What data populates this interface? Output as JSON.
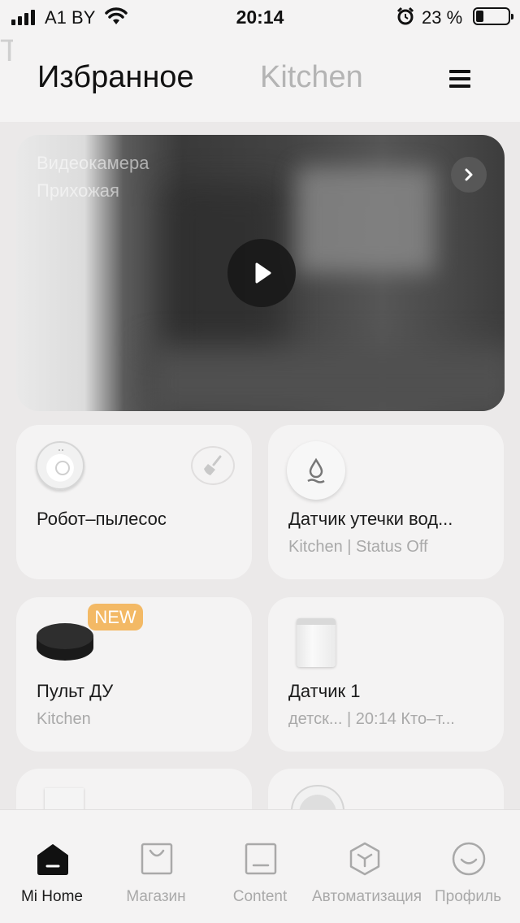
{
  "status_bar": {
    "carrier": "A1 BY",
    "time": "20:14",
    "battery_percent": "23 %",
    "battery_level": 0.23,
    "icons": [
      "signal-icon",
      "wifi-icon",
      "alarm-icon",
      "battery-icon"
    ]
  },
  "header": {
    "tabs": [
      {
        "label": "Избранное",
        "active": true
      },
      {
        "label": "Kitchen",
        "active": false
      },
      {
        "label": "Т",
        "active": false
      }
    ],
    "menu_icon": "menu-icon"
  },
  "camera": {
    "name": "Видеокамера",
    "room": "Прихожая",
    "next_icon": "chevron-right-icon",
    "play_icon": "play-icon"
  },
  "devices": [
    {
      "name": "Робот–пылесос",
      "sub": "",
      "icon": "robot-vacuum-icon",
      "action_icon": "broom-icon"
    },
    {
      "name": "Датчик утечки вод...",
      "sub": "Kitchen | Status Off",
      "icon": "water-leak-sensor-icon"
    },
    {
      "name": "Пульт ДУ",
      "sub": "Kitchen",
      "icon": "ir-remote-hub-icon",
      "badge": "NEW"
    },
    {
      "name": "Датчик 1",
      "sub": "детск... | 20:14 Кто–т...",
      "icon": "motion-sensor-icon"
    },
    {
      "name": "",
      "sub": "",
      "icon": "motion-sensor-icon"
    },
    {
      "name": "",
      "sub": "",
      "icon": "thermometer-clock-icon"
    }
  ],
  "bottom_nav": {
    "items": [
      {
        "label": "Mi Home",
        "icon": "home-icon",
        "active": true
      },
      {
        "label": "Магазин",
        "icon": "shopping-bag-icon",
        "active": false
      },
      {
        "label": "Content",
        "icon": "content-icon",
        "active": false
      },
      {
        "label": "Автоматизация",
        "icon": "automation-icon",
        "active": false
      },
      {
        "label": "Профиль",
        "icon": "profile-icon",
        "active": false
      }
    ]
  }
}
